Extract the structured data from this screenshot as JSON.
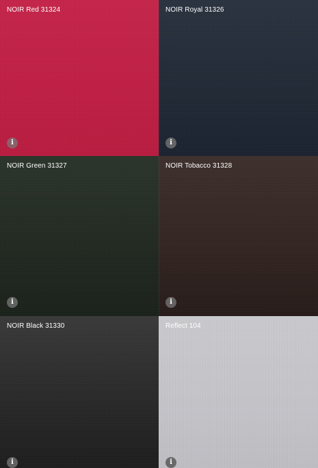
{
  "swatches": [
    {
      "label": "NOIR Red 31324",
      "info_icon": "i",
      "color": "#bf2045"
    },
    {
      "label": "NOIR Royal 31326",
      "info_icon": "i",
      "color": "#222a36"
    },
    {
      "label": "NOIR Green 31327",
      "info_icon": "i",
      "color": "#222a22"
    },
    {
      "label": "NOIR Tobacco 31328",
      "info_icon": "i",
      "color": "#332623"
    },
    {
      "label": "NOIR Black 31330",
      "info_icon": "i",
      "color": "#2b2b2b"
    },
    {
      "label": "Reflect 104",
      "info_icon": "i",
      "color": "#c3c3c8"
    }
  ]
}
